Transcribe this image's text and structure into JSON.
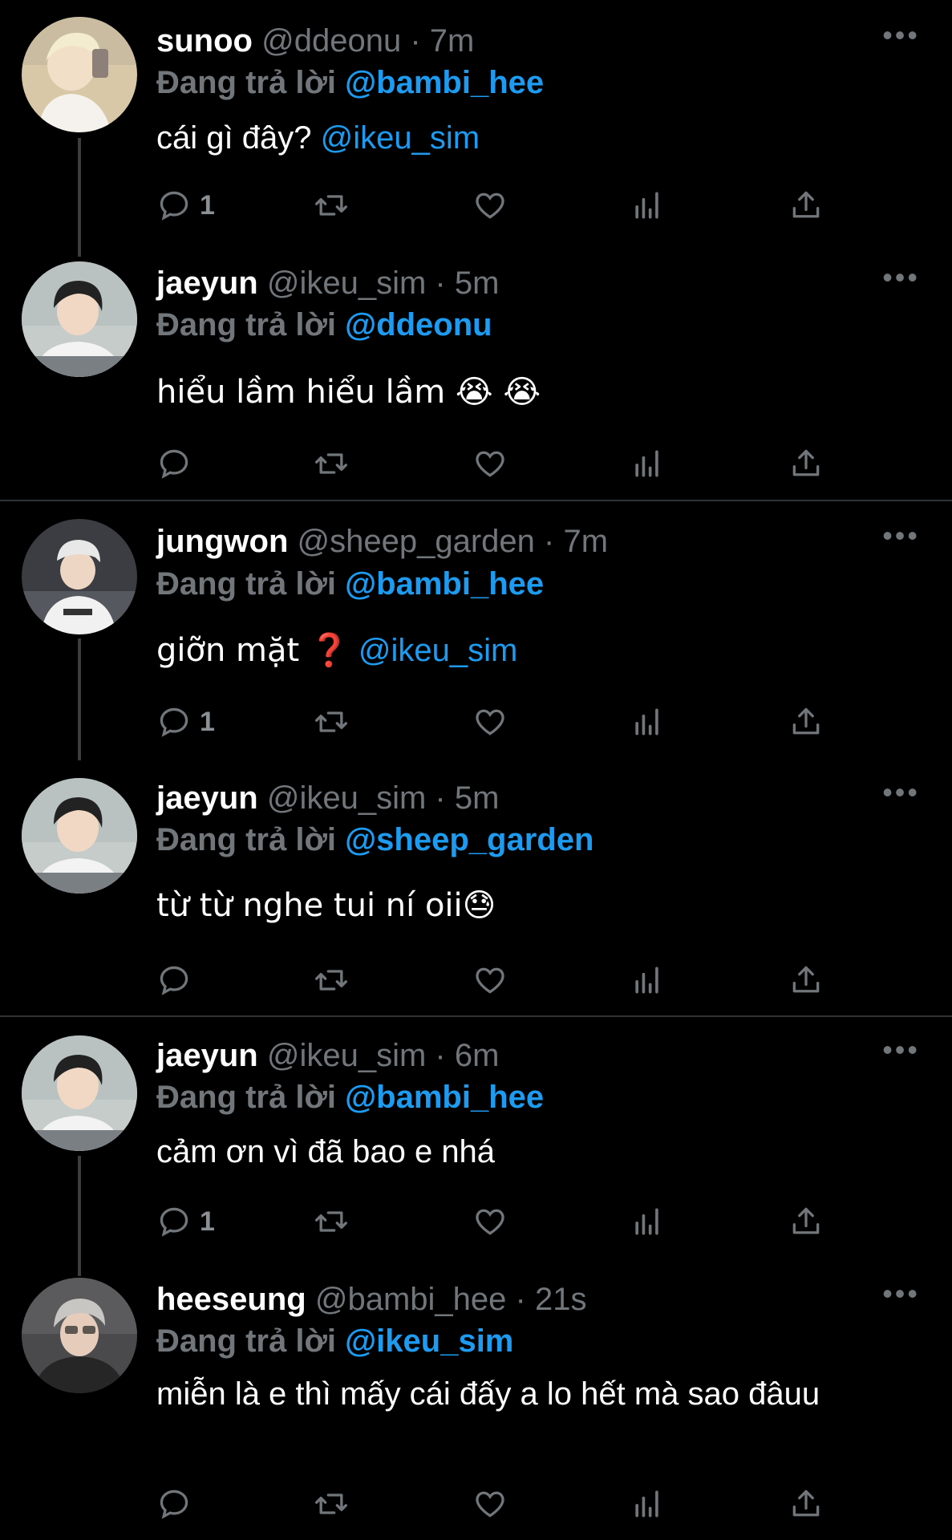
{
  "replying_prefix": "Đang trả lời",
  "more_label": "•••",
  "tweets": [
    {
      "name": "sunoo",
      "handle": "@ddeonu",
      "time": "· 7m",
      "replying_to": "@bambi_hee",
      "text": "cái gì đây?",
      "mention_in_text": "@ikeu_sim",
      "reply_count": "1"
    },
    {
      "name": "jaeyun",
      "handle": "@ikeu_sim",
      "time": "· 5m",
      "replying_to": "@ddeonu",
      "text": "hiểu lầm hiểu lầm 😭 😭",
      "reply_count": ""
    },
    {
      "name": "jungwon",
      "handle": "@sheep_garden",
      "time": "· 7m",
      "replying_to": "@bambi_hee",
      "text": "giỡn mặt ❓",
      "mention_in_text": "@ikeu_sim",
      "reply_count": "1"
    },
    {
      "name": "jaeyun",
      "handle": "@ikeu_sim",
      "time": "· 5m",
      "replying_to": "@sheep_garden",
      "text": "từ từ nghe tui ní oii😓",
      "reply_count": ""
    },
    {
      "name": "jaeyun",
      "handle": "@ikeu_sim",
      "time": "· 6m",
      "replying_to": "@bambi_hee",
      "text": "cảm ơn vì đã bao e nhá",
      "reply_count": "1"
    },
    {
      "name": "heeseung",
      "handle": "@bambi_hee",
      "time": "· 21s",
      "replying_to": "@ikeu_sim",
      "text": "miễn là e thì mấy cái đấy a lo hết mà sao đâuu",
      "reply_count": ""
    }
  ],
  "colors": {
    "background": "#000000",
    "mention": "#1d9bf0",
    "muted": "#71767b",
    "thread_line": "#3a3e43",
    "divider": "#2f3336"
  }
}
